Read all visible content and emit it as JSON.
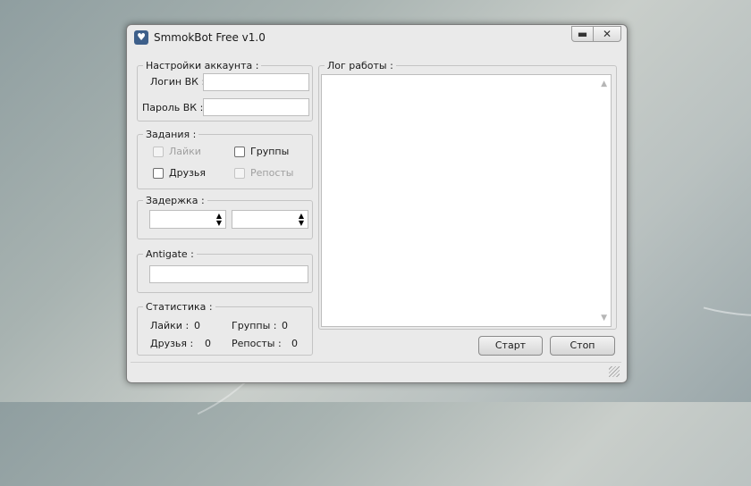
{
  "window": {
    "title": "SmmokBot Free v1.0",
    "app_icon": "heart-icon",
    "minimize_glyph": "▬",
    "close_glyph": "✕"
  },
  "account": {
    "legend": "Настройки аккаунта :",
    "login_label": "Логин ВК :",
    "login_value": "",
    "password_label": "Пароль ВК :",
    "password_value": ""
  },
  "tasks": {
    "legend": "Задания :",
    "likes": {
      "label": "Лайки",
      "checked": false,
      "enabled": false
    },
    "groups": {
      "label": "Группы",
      "checked": false,
      "enabled": true
    },
    "friends": {
      "label": "Друзья",
      "checked": false,
      "enabled": true
    },
    "reposts": {
      "label": "Репосты",
      "checked": false,
      "enabled": false
    }
  },
  "delay": {
    "legend": "Задержка :",
    "from_value": "",
    "to_value": ""
  },
  "antigate": {
    "legend": "Antigate :",
    "value": ""
  },
  "stats": {
    "legend": "Статистика :",
    "likes_label": "Лайки :",
    "likes_value": "0",
    "groups_label": "Группы :",
    "groups_value": "0",
    "friends_label": "Друзья :",
    "friends_value": "0",
    "reposts_label": "Репосты :",
    "reposts_value": "0"
  },
  "log": {
    "legend": "Лог работы :",
    "content": ""
  },
  "buttons": {
    "start": "Старт",
    "stop": "Стоп"
  }
}
